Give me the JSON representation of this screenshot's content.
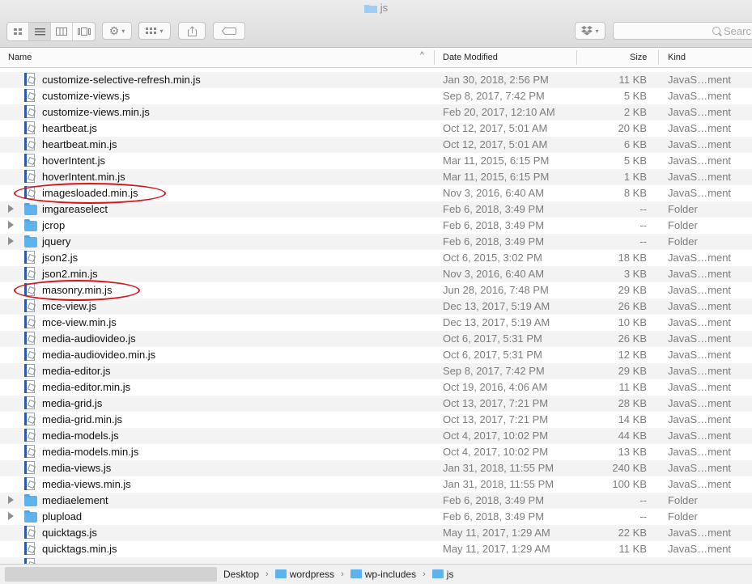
{
  "window": {
    "title": "js",
    "title_icon": "folder-icon"
  },
  "toolbar": {
    "view_buttons": [
      "icon-view-icon",
      "list-view-icon",
      "column-view-icon",
      "cover-flow-icon"
    ],
    "action_icon": "gear-icon",
    "arrange_icon": "grid-arrange-icon",
    "share_icon": "share-icon",
    "tag_icon": "tag-icon",
    "dropbox_icon": "dropbox-icon",
    "search_placeholder": "Search"
  },
  "columns": {
    "name": "Name",
    "date": "Date Modified",
    "size": "Size",
    "kind": "Kind"
  },
  "sort_indicator": "^",
  "files": [
    {
      "name": "customize-selective-refresh.min.js",
      "date": "Jan 30, 2018, 2:56 PM",
      "size": "11 KB",
      "kind": "JavaS…ment",
      "type": "js"
    },
    {
      "name": "customize-views.js",
      "date": "Sep 8, 2017, 7:42 PM",
      "size": "5 KB",
      "kind": "JavaS…ment",
      "type": "js"
    },
    {
      "name": "customize-views.min.js",
      "date": "Feb 20, 2017, 12:10 AM",
      "size": "2 KB",
      "kind": "JavaS…ment",
      "type": "js"
    },
    {
      "name": "heartbeat.js",
      "date": "Oct 12, 2017, 5:01 AM",
      "size": "20 KB",
      "kind": "JavaS…ment",
      "type": "js"
    },
    {
      "name": "heartbeat.min.js",
      "date": "Oct 12, 2017, 5:01 AM",
      "size": "6 KB",
      "kind": "JavaS…ment",
      "type": "js"
    },
    {
      "name": "hoverIntent.js",
      "date": "Mar 11, 2015, 6:15 PM",
      "size": "5 KB",
      "kind": "JavaS…ment",
      "type": "js"
    },
    {
      "name": "hoverIntent.min.js",
      "date": "Mar 11, 2015, 6:15 PM",
      "size": "1 KB",
      "kind": "JavaS…ment",
      "type": "js"
    },
    {
      "name": "imagesloaded.min.js",
      "date": "Nov 3, 2016, 6:40 AM",
      "size": "8 KB",
      "kind": "JavaS…ment",
      "type": "js",
      "circled": true
    },
    {
      "name": "imgareaselect",
      "date": "Feb 6, 2018, 3:49 PM",
      "size": "--",
      "kind": "Folder",
      "type": "folder"
    },
    {
      "name": "jcrop",
      "date": "Feb 6, 2018, 3:49 PM",
      "size": "--",
      "kind": "Folder",
      "type": "folder"
    },
    {
      "name": "jquery",
      "date": "Feb 6, 2018, 3:49 PM",
      "size": "--",
      "kind": "Folder",
      "type": "folder"
    },
    {
      "name": "json2.js",
      "date": "Oct 6, 2015, 3:02 PM",
      "size": "18 KB",
      "kind": "JavaS…ment",
      "type": "js"
    },
    {
      "name": "json2.min.js",
      "date": "Nov 3, 2016, 6:40 AM",
      "size": "3 KB",
      "kind": "JavaS…ment",
      "type": "js"
    },
    {
      "name": "masonry.min.js",
      "date": "Jun 28, 2016, 7:48 PM",
      "size": "29 KB",
      "kind": "JavaS…ment",
      "type": "js",
      "circled": true
    },
    {
      "name": "mce-view.js",
      "date": "Dec 13, 2017, 5:19 AM",
      "size": "26 KB",
      "kind": "JavaS…ment",
      "type": "js"
    },
    {
      "name": "mce-view.min.js",
      "date": "Dec 13, 2017, 5:19 AM",
      "size": "10 KB",
      "kind": "JavaS…ment",
      "type": "js"
    },
    {
      "name": "media-audiovideo.js",
      "date": "Oct 6, 2017, 5:31 PM",
      "size": "26 KB",
      "kind": "JavaS…ment",
      "type": "js"
    },
    {
      "name": "media-audiovideo.min.js",
      "date": "Oct 6, 2017, 5:31 PM",
      "size": "12 KB",
      "kind": "JavaS…ment",
      "type": "js"
    },
    {
      "name": "media-editor.js",
      "date": "Sep 8, 2017, 7:42 PM",
      "size": "29 KB",
      "kind": "JavaS…ment",
      "type": "js"
    },
    {
      "name": "media-editor.min.js",
      "date": "Oct 19, 2016, 4:06 AM",
      "size": "11 KB",
      "kind": "JavaS…ment",
      "type": "js"
    },
    {
      "name": "media-grid.js",
      "date": "Oct 13, 2017, 7:21 PM",
      "size": "28 KB",
      "kind": "JavaS…ment",
      "type": "js"
    },
    {
      "name": "media-grid.min.js",
      "date": "Oct 13, 2017, 7:21 PM",
      "size": "14 KB",
      "kind": "JavaS…ment",
      "type": "js"
    },
    {
      "name": "media-models.js",
      "date": "Oct 4, 2017, 10:02 PM",
      "size": "44 KB",
      "kind": "JavaS…ment",
      "type": "js"
    },
    {
      "name": "media-models.min.js",
      "date": "Oct 4, 2017, 10:02 PM",
      "size": "13 KB",
      "kind": "JavaS…ment",
      "type": "js"
    },
    {
      "name": "media-views.js",
      "date": "Jan 31, 2018, 11:55 PM",
      "size": "240 KB",
      "kind": "JavaS…ment",
      "type": "js"
    },
    {
      "name": "media-views.min.js",
      "date": "Jan 31, 2018, 11:55 PM",
      "size": "100 KB",
      "kind": "JavaS…ment",
      "type": "js"
    },
    {
      "name": "mediaelement",
      "date": "Feb 6, 2018, 3:49 PM",
      "size": "--",
      "kind": "Folder",
      "type": "folder"
    },
    {
      "name": "plupload",
      "date": "Feb 6, 2018, 3:49 PM",
      "size": "--",
      "kind": "Folder",
      "type": "folder"
    },
    {
      "name": "quicktags.js",
      "date": "May 11, 2017, 1:29 AM",
      "size": "22 KB",
      "kind": "JavaS…ment",
      "type": "js"
    },
    {
      "name": "quicktags.min.js",
      "date": "May 11, 2017, 1:29 AM",
      "size": "11 KB",
      "kind": "JavaS…ment",
      "type": "js"
    }
  ],
  "pathbar": {
    "crumbs": [
      "Desktop",
      "wordpress",
      "wp-includes",
      "js"
    ]
  }
}
